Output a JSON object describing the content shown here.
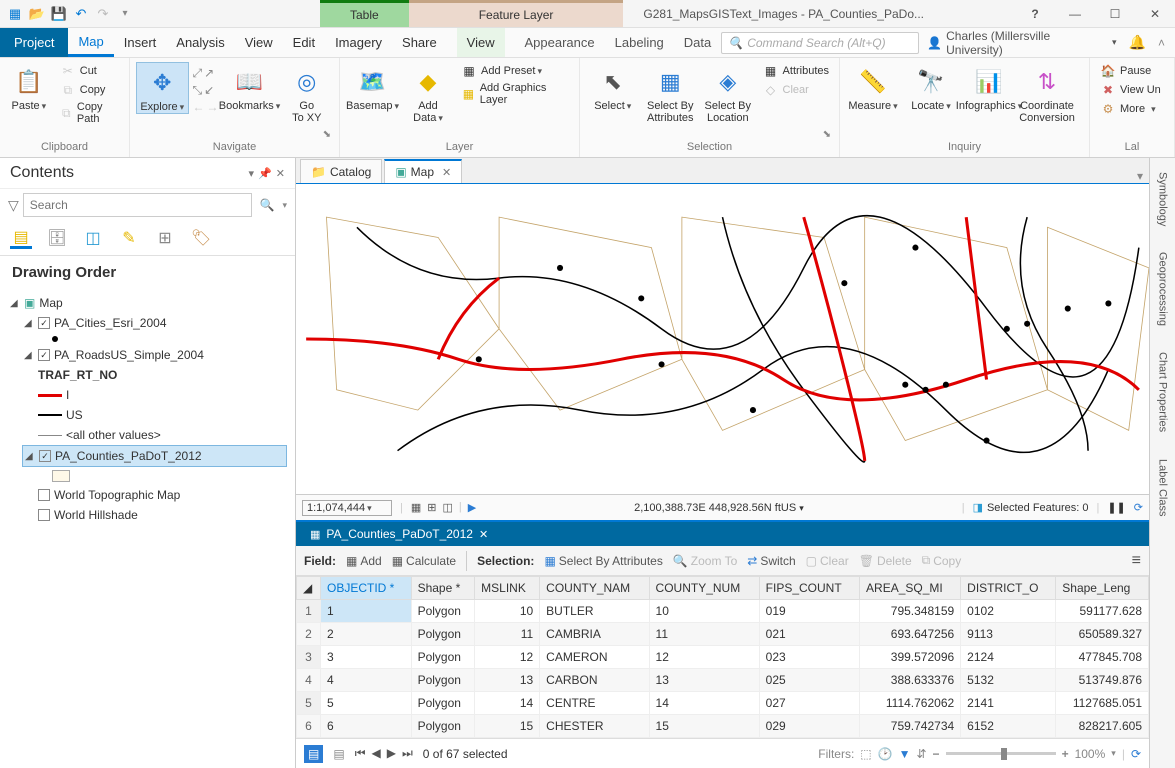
{
  "title": "G281_MapsGISText_Images - PA_Counties_PaDo...",
  "context_tabs": {
    "table": "Table",
    "layer": "Feature Layer"
  },
  "ribbon_tabs": [
    "Project",
    "Map",
    "Insert",
    "Analysis",
    "View",
    "Edit",
    "Imagery",
    "Share"
  ],
  "ribbon_ctx": {
    "view": "View",
    "appearance": "Appearance",
    "labeling": "Labeling",
    "data": "Data"
  },
  "cmd_search_placeholder": "Command Search (Alt+Q)",
  "user": "Charles (Millersville University)",
  "ribbon": {
    "clipboard": {
      "paste": "Paste",
      "cut": "Cut",
      "copy": "Copy",
      "copypath": "Copy Path",
      "label": "Clipboard"
    },
    "navigate": {
      "explore": "Explore",
      "bookmarks": "Bookmarks",
      "gotoxy": "Go\nTo XY",
      "label": "Navigate"
    },
    "layer": {
      "basemap": "Basemap",
      "adddata": "Add\nData",
      "addpreset": "Add Preset",
      "addgraphics": "Add Graphics Layer",
      "label": "Layer"
    },
    "selection": {
      "select": "Select",
      "selbyattr": "Select By\nAttributes",
      "selbyloc": "Select By\nLocation",
      "attributes": "Attributes",
      "clear": "Clear",
      "label": "Selection"
    },
    "inquiry": {
      "measure": "Measure",
      "locate": "Locate",
      "infographics": "Infographics",
      "coord": "Coordinate\nConversion",
      "label": "Inquiry"
    },
    "labeling": {
      "pause": "Pause",
      "viewun": "View Un",
      "more": "More",
      "label": "Lal"
    }
  },
  "contents": {
    "title": "Contents",
    "search_placeholder": "Search",
    "section": "Drawing Order",
    "map": "Map",
    "layers": {
      "cities": "PA_Cities_Esri_2004",
      "roads": "PA_RoadsUS_Simple_2004",
      "traf": "TRAF_RT_NO",
      "i": "I",
      "us": "US",
      "other": "<all other values>",
      "counties": "PA_Counties_PaDoT_2012",
      "topo": "World Topographic Map",
      "hillshade": "World Hillshade"
    }
  },
  "views": {
    "catalog": "Catalog",
    "map": "Map"
  },
  "map_status": {
    "scale": "1:1,074,444",
    "coords": "2,100,388.73E 448,928.56N ftUS",
    "selected": "Selected Features: 0"
  },
  "attr": {
    "tab": "PA_Counties_PaDoT_2012",
    "field_label": "Field:",
    "add": "Add",
    "calculate": "Calculate",
    "selection_label": "Selection:",
    "selbyattr": "Select By Attributes",
    "zoomto": "Zoom To",
    "switch": "Switch",
    "clear": "Clear",
    "delete": "Delete",
    "copy": "Copy",
    "columns": [
      "OBJECTID *",
      "Shape *",
      "MSLINK",
      "COUNTY_NAM",
      "COUNTY_NUM",
      "FIPS_COUNT",
      "AREA_SQ_MI",
      "DISTRICT_O",
      "Shape_Leng"
    ],
    "rows": [
      {
        "n": 1,
        "oid": "1",
        "shape": "Polygon",
        "ms": "10",
        "cnam": "BUTLER",
        "cnum": "10",
        "fips": "019",
        "area": "795.348159",
        "dist": "0102",
        "len": "591177.628"
      },
      {
        "n": 2,
        "oid": "2",
        "shape": "Polygon",
        "ms": "11",
        "cnam": "CAMBRIA",
        "cnum": "11",
        "fips": "021",
        "area": "693.647256",
        "dist": "9113",
        "len": "650589.327"
      },
      {
        "n": 3,
        "oid": "3",
        "shape": "Polygon",
        "ms": "12",
        "cnam": "CAMERON",
        "cnum": "12",
        "fips": "023",
        "area": "399.572096",
        "dist": "2124",
        "len": "477845.708"
      },
      {
        "n": 4,
        "oid": "4",
        "shape": "Polygon",
        "ms": "13",
        "cnam": "CARBON",
        "cnum": "13",
        "fips": "025",
        "area": "388.633376",
        "dist": "5132",
        "len": "513749.876"
      },
      {
        "n": 5,
        "oid": "5",
        "shape": "Polygon",
        "ms": "14",
        "cnam": "CENTRE",
        "cnum": "14",
        "fips": "027",
        "area": "1114.762062",
        "dist": "2141",
        "len": "1127685.051"
      },
      {
        "n": 6,
        "oid": "6",
        "shape": "Polygon",
        "ms": "15",
        "cnam": "CHESTER",
        "cnum": "15",
        "fips": "029",
        "area": "759.742734",
        "dist": "6152",
        "len": "828217.605"
      }
    ],
    "footer_text": "0 of 67 selected",
    "filters": "Filters:",
    "zoom_pct": "100%"
  },
  "dock": [
    "Symbology",
    "Geoprocessing",
    "Chart Properties",
    "Label Class"
  ]
}
